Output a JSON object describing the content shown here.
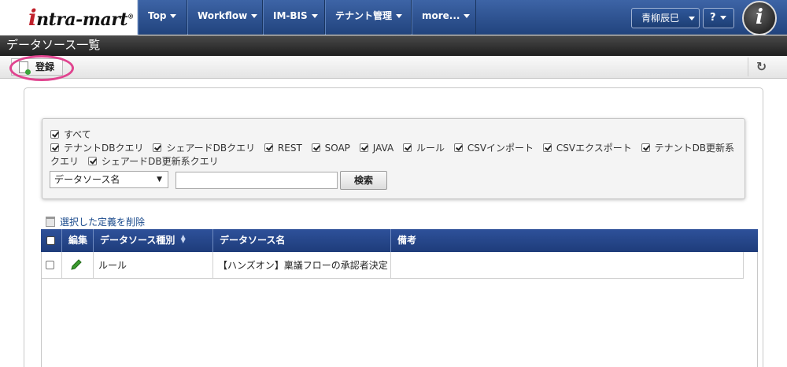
{
  "header": {
    "logo_text": "intra-mart",
    "nav": [
      {
        "label": "Top"
      },
      {
        "label": "Workflow"
      },
      {
        "label": "IM-BIS"
      },
      {
        "label": "テナント管理"
      },
      {
        "label": "more..."
      }
    ],
    "user_name": "青柳辰巳",
    "help_label": "?",
    "avatar_letter": "i"
  },
  "page": {
    "title": "データソース一覧"
  },
  "toolbar": {
    "register_label": "登録"
  },
  "filter": {
    "all_label": "すべて",
    "types": [
      {
        "label": "テナントDBクエリ",
        "checked": true
      },
      {
        "label": "シェアードDBクエリ",
        "checked": true
      },
      {
        "label": "REST",
        "checked": true
      },
      {
        "label": "SOAP",
        "checked": true
      },
      {
        "label": "JAVA",
        "checked": true
      },
      {
        "label": "ルール",
        "checked": true
      },
      {
        "label": "CSVインポート",
        "checked": true
      },
      {
        "label": "CSVエクスポート",
        "checked": true
      },
      {
        "label": "テナントDB更新系クエリ",
        "checked": true
      },
      {
        "label": "シェアードDB更新系クエリ",
        "checked": true
      }
    ],
    "select_value": "データソース名",
    "search_value": "",
    "search_button": "検索"
  },
  "actions": {
    "delete_selected": "選択した定義を削除"
  },
  "grid": {
    "columns": [
      "編集",
      "データソース種別",
      "データソース名",
      "備考"
    ],
    "rows": [
      {
        "type": "ルール",
        "name": "【ハンズオン】稟議フローの承認者決定",
        "note": ""
      }
    ]
  },
  "colors": {
    "nav_blue": "#2b4f8f",
    "title_dark": "#2e2e2e",
    "highlight_pink": "#e0448f",
    "pencil_green": "#3a9a2e"
  }
}
